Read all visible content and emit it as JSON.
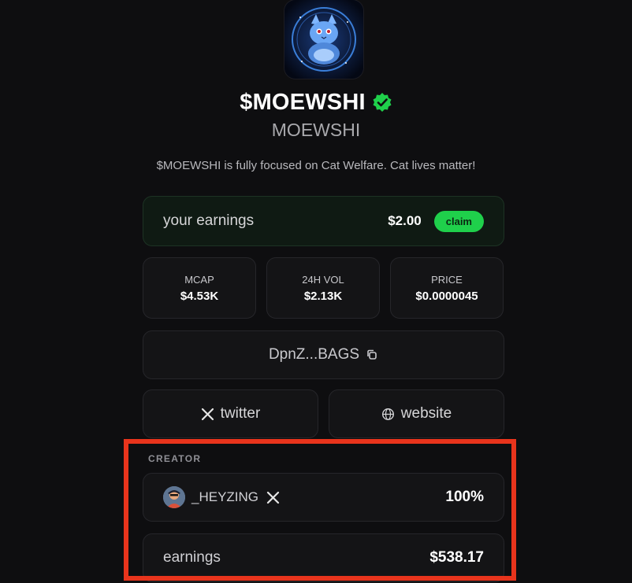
{
  "token": {
    "ticker": "$MOEWSHI",
    "name": "MOEWSHI",
    "description": "$MOEWSHI is fully focused on Cat Welfare. Cat lives matter!",
    "verified_icon": "verified-check-icon"
  },
  "earnings": {
    "label": "your earnings",
    "value": "$2.00",
    "claim_label": "claim"
  },
  "stats": [
    {
      "label": "MCAP",
      "value": "$4.53K"
    },
    {
      "label": "24H VOL",
      "value": "$2.13K"
    },
    {
      "label": "PRICE",
      "value": "$0.0000045"
    }
  ],
  "address": {
    "text": "DpnZ...BAGS",
    "icon": "copy-icon"
  },
  "links": [
    {
      "label": "twitter",
      "icon": "x-icon"
    },
    {
      "label": "website",
      "icon": "globe-icon"
    }
  ],
  "creator": {
    "section_label": "CREATOR",
    "handle": "_HEYZING",
    "share": "100%",
    "earnings_label": "earnings",
    "earnings_value": "$538.17"
  },
  "colors": {
    "background": "#0e0e10",
    "accent_green": "#1fd04b",
    "highlight_red": "#e8341c"
  }
}
